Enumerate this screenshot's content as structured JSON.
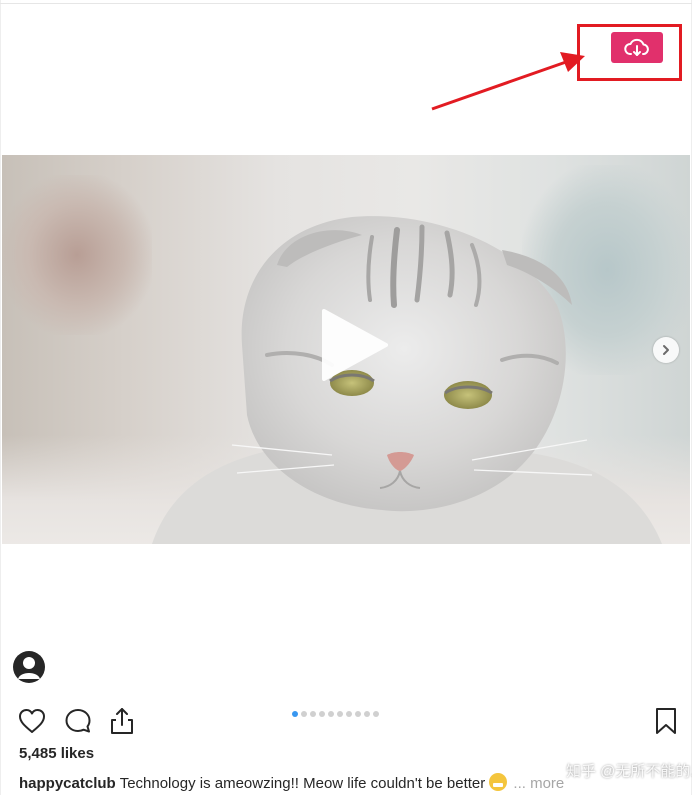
{
  "post": {
    "likes_text": "5,485 likes",
    "username": "happycatclub",
    "caption_text": "Technology is ameowzing!! Meow life couldn't be better",
    "more_label": "... more"
  },
  "carousel": {
    "dot_count": 10,
    "active_index": 0
  },
  "colors": {
    "download_button": "#e1306c",
    "highlight": "#e21b22",
    "like_blue": "#3897f0"
  },
  "icons": {
    "download": "cloud-download-icon",
    "play": "play-icon",
    "next": "chevron-right-icon",
    "avatar": "user-avatar-icon",
    "like": "heart-icon",
    "comment": "comment-icon",
    "share": "share-icon",
    "save": "bookmark-icon"
  },
  "watermark": {
    "text": "知乎 @无所不能的..."
  }
}
